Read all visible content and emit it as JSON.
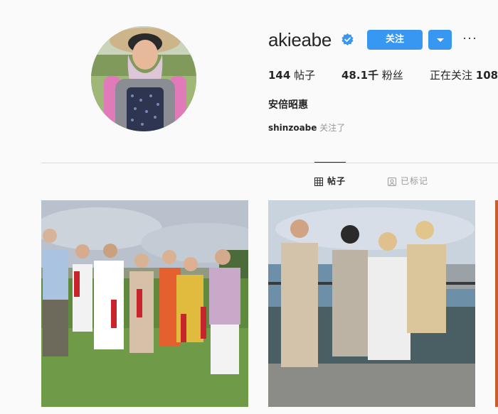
{
  "profile": {
    "username": "akieabe",
    "verified": true,
    "follow_label": "关注",
    "more_label": "···",
    "stats": {
      "posts_count": "144",
      "posts_label": "帖子",
      "followers_count": "48.1千",
      "followers_label": "粉丝",
      "following_label": "正在关注",
      "following_count": "108"
    },
    "full_name": "安倍昭惠",
    "followed_by_user": "shinzoabe",
    "followed_by_suffix": "关注了"
  },
  "tabs": [
    {
      "label": "帖子",
      "icon": "grid-icon",
      "active": true
    },
    {
      "label": "已标记",
      "icon": "tagged-icon",
      "active": false
    }
  ],
  "colors": {
    "accent": "#3897f0",
    "verified": "#3897f0",
    "text": "#262626",
    "muted": "#999999",
    "divider": "#dbdbdb",
    "background": "#fafafa"
  }
}
